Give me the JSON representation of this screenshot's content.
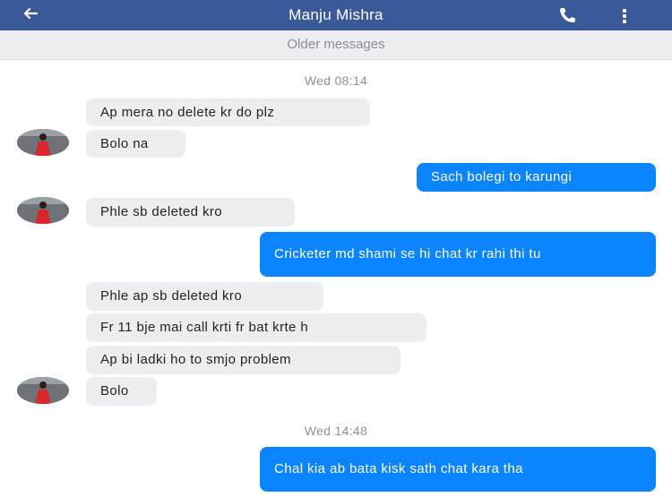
{
  "header": {
    "title": "Manju Mishra",
    "back_icon": "back-arrow-icon",
    "call_icon": "phone-icon",
    "menu_icon": "more-vertical-icon",
    "color": "#3b5998"
  },
  "older_messages_label": "Older messages",
  "timestamps": [
    "Wed 08:14",
    "Wed 14:48"
  ],
  "messages": [
    {
      "side": "in",
      "text": "Ap mera no delete kr do plz"
    },
    {
      "side": "in",
      "text": "Bolo na"
    },
    {
      "side": "out",
      "text": "Sach bolegi to karungi"
    },
    {
      "side": "in",
      "text": "Phle sb deleted kro"
    },
    {
      "side": "out",
      "text": "Cricketer md shami se hi chat kr rahi thi tu"
    },
    {
      "side": "in",
      "text": "Phle ap sb deleted kro"
    },
    {
      "side": "in",
      "text": "Fr 11 bje mai call krti fr bat krte h"
    },
    {
      "side": "in",
      "text": "Ap bi ladki ho to smjo problem"
    },
    {
      "side": "in",
      "text": "Bolo"
    },
    {
      "side": "out",
      "text": "Chal kia ab bata kisk sath chat kara tha"
    }
  ],
  "colors": {
    "incoming_bubble": "#ecedf0",
    "outgoing_bubble": "#0a84ff"
  }
}
